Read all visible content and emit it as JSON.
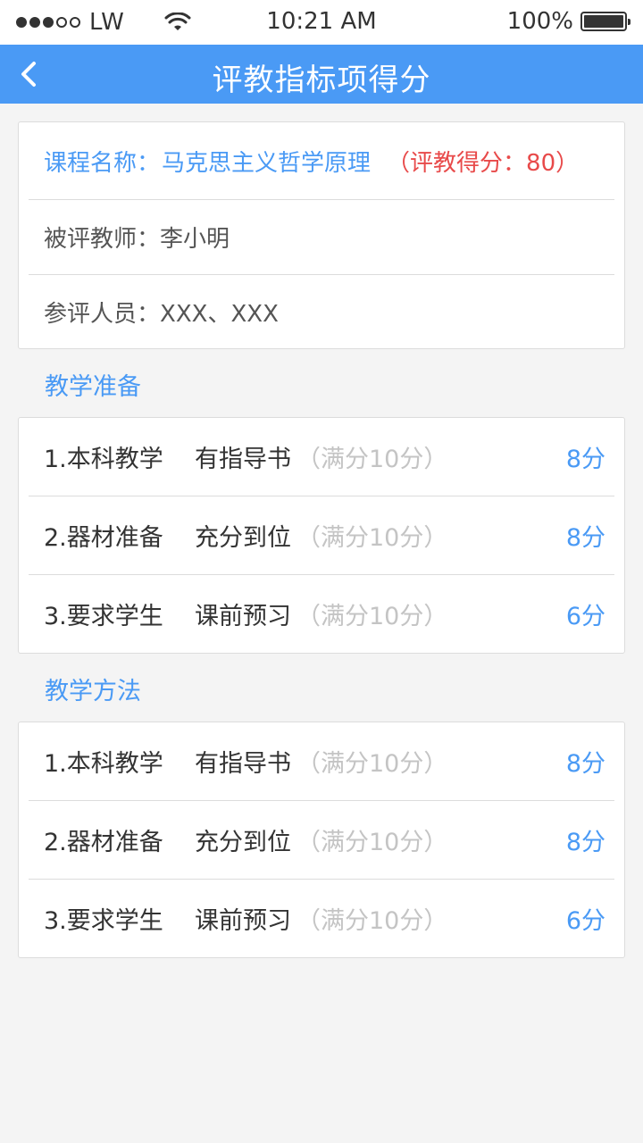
{
  "status_bar": {
    "carrier": "LW",
    "time": "10:21 AM",
    "battery": "100%"
  },
  "nav": {
    "title": "评教指标项得分"
  },
  "info": {
    "course_label": "课程名称：",
    "course_name": "马克思主义哲学原理",
    "score_text": "（评教得分：80）",
    "teacher_label": "被评教师：",
    "teacher_name": "李小明",
    "people_label": "参评人员：",
    "people_value": "XXX、XXX"
  },
  "sections": [
    {
      "title": "教学准备",
      "items": [
        {
          "name": "1.本科教学",
          "desc": "有指导书",
          "full": "（满分10分）",
          "score": "8分"
        },
        {
          "name": "2.器材准备",
          "desc": "充分到位",
          "full": "（满分10分）",
          "score": "8分"
        },
        {
          "name": "3.要求学生",
          "desc": "课前预习",
          "full": "（满分10分）",
          "score": "6分"
        }
      ]
    },
    {
      "title": "教学方法",
      "items": [
        {
          "name": "1.本科教学",
          "desc": "有指导书",
          "full": "（满分10分）",
          "score": "8分"
        },
        {
          "name": "2.器材准备",
          "desc": "充分到位",
          "full": "（满分10分）",
          "score": "8分"
        },
        {
          "name": "3.要求学生",
          "desc": "课前预习",
          "full": "（满分10分）",
          "score": "6分"
        }
      ]
    }
  ],
  "colors": {
    "accent": "#4a9af5",
    "score_red": "#e84a4a",
    "muted": "#c4c4c4",
    "background": "#f4f4f4"
  },
  "icons": {
    "back": "chevron-left-icon",
    "wifi": "wifi-icon",
    "battery": "battery-icon",
    "signal": "signal-dots-icon"
  }
}
